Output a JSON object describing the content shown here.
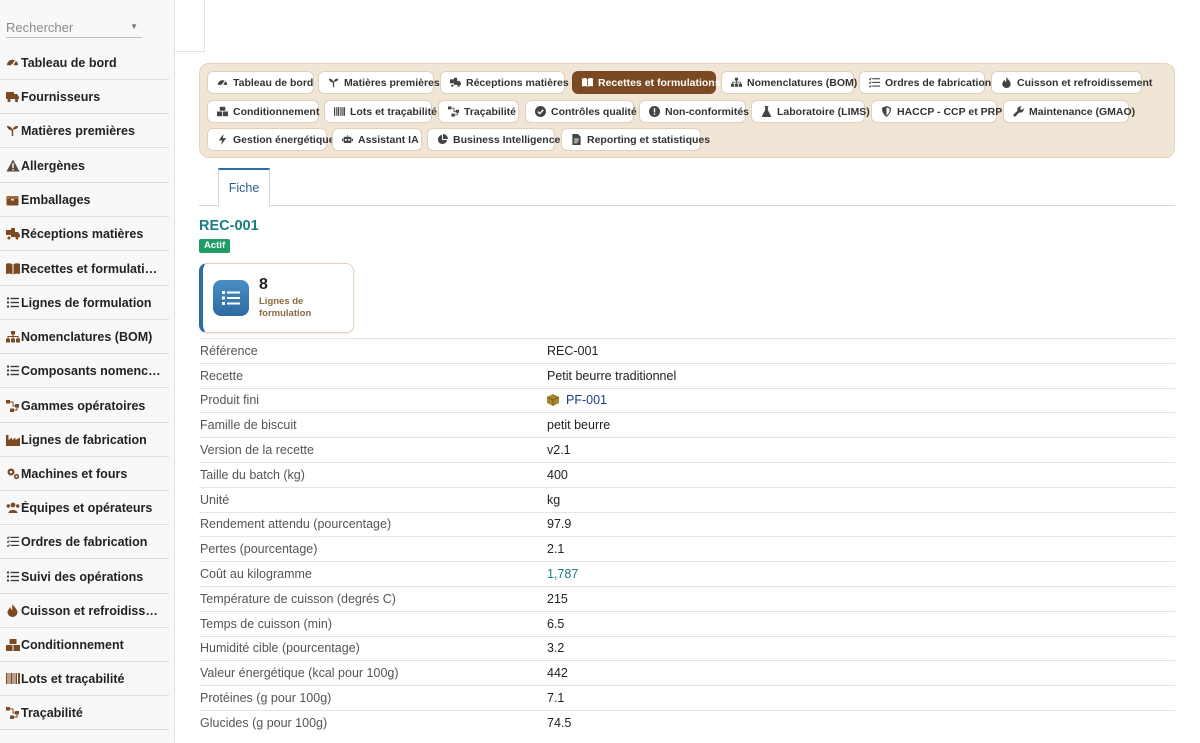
{
  "search": {
    "placeholder": "Rechercher"
  },
  "sidebar": {
    "items": [
      {
        "label": "Tableau de bord",
        "icon": "gauge-icon"
      },
      {
        "label": "Fournisseurs",
        "icon": "truck-icon"
      },
      {
        "label": "Matières premières",
        "icon": "seedling-icon"
      },
      {
        "label": "Allergènes",
        "icon": "warning-icon"
      },
      {
        "label": "Emballages",
        "icon": "box-icon"
      },
      {
        "label": "Réceptions matières",
        "icon": "truck-loading-icon"
      },
      {
        "label": "Recettes et formulations",
        "icon": "book-icon"
      },
      {
        "label": "Lignes de formulation",
        "icon": "list-icon"
      },
      {
        "label": "Nomenclatures (BOM)",
        "icon": "sitemap-icon"
      },
      {
        "label": "Composants nomenclature",
        "icon": "list-icon"
      },
      {
        "label": "Gammes opératoires",
        "icon": "route-icon"
      },
      {
        "label": "Lignes de fabrication",
        "icon": "industry-icon"
      },
      {
        "label": "Machines et fours",
        "icon": "cogs-icon"
      },
      {
        "label": "Équipes et opérateurs",
        "icon": "users-icon"
      },
      {
        "label": "Ordres de fabrication",
        "icon": "checklist-icon"
      },
      {
        "label": "Suivi des opérations",
        "icon": "list-icon"
      },
      {
        "label": "Cuisson et refroidissement",
        "icon": "fire-icon"
      },
      {
        "label": "Conditionnement",
        "icon": "boxes-icon"
      },
      {
        "label": "Lots et traçabilité",
        "icon": "barcode-icon"
      },
      {
        "label": "Traçabilité",
        "icon": "route-icon"
      }
    ]
  },
  "modules": [
    {
      "label": "Tableau de bord",
      "icon": "gauge-icon"
    },
    {
      "label": "Matières premières",
      "icon": "seedling-icon"
    },
    {
      "label": "Réceptions matières",
      "icon": "truck-loading-icon"
    },
    {
      "label": "Recettes et formulations",
      "icon": "book-icon",
      "active": true
    },
    {
      "label": "Nomenclatures (BOM)",
      "icon": "sitemap-icon"
    },
    {
      "label": "Ordres de fabrication",
      "icon": "checklist-icon"
    },
    {
      "label": "Cuisson et refroidissement",
      "icon": "fire-icon"
    },
    {
      "label": "Conditionnement",
      "icon": "boxes-icon"
    },
    {
      "label": "Lots et traçabilité",
      "icon": "barcode-icon"
    },
    {
      "label": "Traçabilité",
      "icon": "route-icon"
    },
    {
      "label": "Contrôles qualité",
      "icon": "check-circle-icon"
    },
    {
      "label": "Non-conformités",
      "icon": "exclamation-circle-icon"
    },
    {
      "label": "Laboratoire (LIMS)",
      "icon": "flask-icon"
    },
    {
      "label": "HACCP - CCP et PRP",
      "icon": "shield-icon"
    },
    {
      "label": "Maintenance (GMAO)",
      "icon": "wrench-icon"
    },
    {
      "label": "Gestion énergétique",
      "icon": "bolt-icon"
    },
    {
      "label": "Assistant IA",
      "icon": "robot-icon"
    },
    {
      "label": "Business Intelligence",
      "icon": "chart-pie-icon"
    },
    {
      "label": "Reporting et statistiques",
      "icon": "file-report-icon"
    }
  ],
  "tabs": [
    {
      "label": "Fiche"
    }
  ],
  "record": {
    "title": "REC-001",
    "status": "Actif",
    "colors": {
      "accent": "#1a7d84",
      "status": "#1e9e64",
      "active_module": "#7b4a22"
    }
  },
  "stat_card": {
    "value": "8",
    "label": "Lignes de formulation",
    "icon": "list-icon"
  },
  "fields": [
    {
      "label": "Référence",
      "value": "REC-001"
    },
    {
      "label": "Recette",
      "value": "Petit beurre traditionnel"
    },
    {
      "label": "Produit fini",
      "value": "PF-001",
      "icon": "cube-icon",
      "kind": "ref"
    },
    {
      "label": "Famille de biscuit",
      "value": "petit beurre"
    },
    {
      "label": "Version de la recette",
      "value": "v2.1"
    },
    {
      "label": "Taille du batch (kg)",
      "value": "400"
    },
    {
      "label": "Unité",
      "value": "kg"
    },
    {
      "label": "Rendement attendu (pourcentage)",
      "value": "97.9"
    },
    {
      "label": "Pertes (pourcentage)",
      "value": "2.1"
    },
    {
      "label": "Coût au kilogramme",
      "value": "1,787",
      "kind": "link"
    },
    {
      "label": "Température de cuisson (degrés C)",
      "value": "215"
    },
    {
      "label": "Temps de cuisson (min)",
      "value": "6.5"
    },
    {
      "label": "Humidité cible (pourcentage)",
      "value": "3.2"
    },
    {
      "label": "Valeur énergétique (kcal pour 100g)",
      "value": "442"
    },
    {
      "label": "Protéines (g pour 100g)",
      "value": "7.1"
    },
    {
      "label": "Glucides (g pour 100g)",
      "value": "74.5"
    }
  ]
}
